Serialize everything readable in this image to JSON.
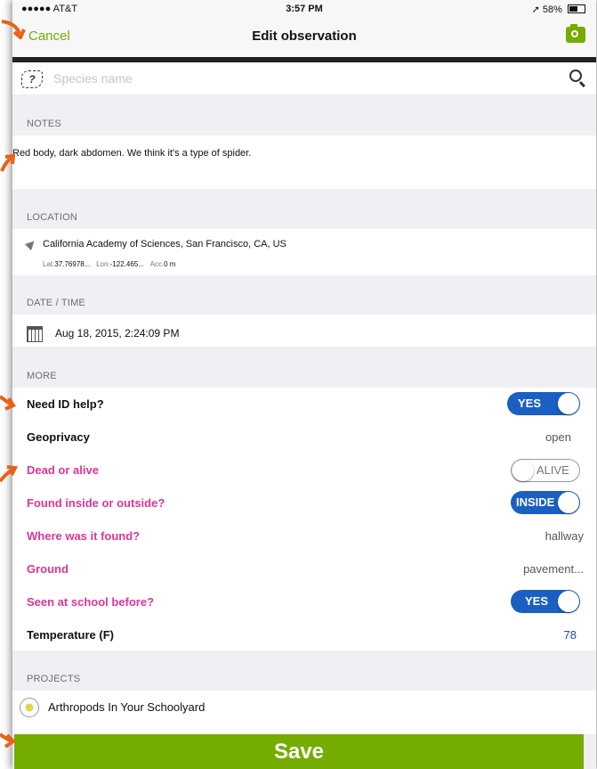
{
  "status": {
    "carrier": "●●●●● AT&T",
    "time": "3:57 PM",
    "battery": "58%"
  },
  "nav": {
    "title": "Edit observation",
    "cancel": "Cancel"
  },
  "species": {
    "placeholder": "Species name",
    "icon": "question-leaf-icon"
  },
  "notes": {
    "header": "NOTES",
    "text": "Red body, dark abdomen. We think it's a type of spider."
  },
  "location": {
    "header": "LOCATION",
    "name": "California Academy of Sciences, San Francisco, CA, US",
    "lat_label": "Lat:",
    "lat": "37.76978...",
    "lon_label": "Lon:",
    "lon": "-122.465...",
    "acc_label": "Acc.",
    "acc": "0 m"
  },
  "datetime": {
    "header": "DATE / TIME",
    "value": "Aug 18, 2015, 2:24:09 PM"
  },
  "more": {
    "header": "MORE",
    "rows": [
      {
        "label": "Need ID help?",
        "value": "YES"
      },
      {
        "label": "Geoprivacy",
        "value": "open"
      },
      {
        "label": "Dead or alive",
        "value": "ALIVE"
      },
      {
        "label": "Found inside or outside?",
        "value": "INSIDE"
      },
      {
        "label": "Where was it found?",
        "value": "hallway"
      },
      {
        "label": "Ground",
        "value": "pavement..."
      },
      {
        "label": "Seen at school before?",
        "value": "YES"
      },
      {
        "label": "Temperature (F)",
        "value": "78"
      }
    ]
  },
  "projects": {
    "header": "PROJECTS",
    "items": [
      {
        "name": "Arthropods In Your Schoolyard"
      }
    ]
  },
  "save_label": "Save",
  "colors": {
    "accent_green": "#74ac00",
    "toggle_blue": "#1b5fc2",
    "field_pink": "#e0349a",
    "annotation_orange": "#e8621a"
  }
}
